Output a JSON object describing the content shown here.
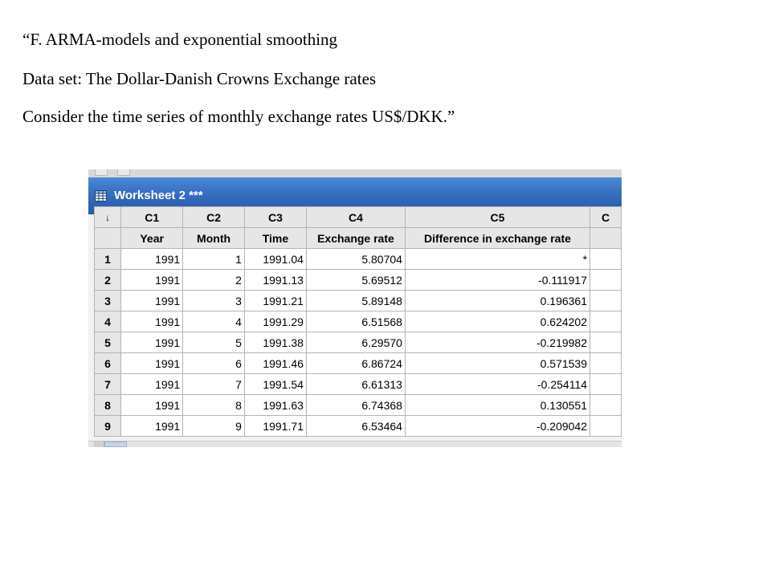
{
  "slide": {
    "line1": "“F. ARMA-models and exponential smoothing",
    "line2": "Data set:  The Dollar-Danish Crowns Exchange rates",
    "line3": "Consider the time series of monthly exchange rates US$/DKK.”"
  },
  "worksheet": {
    "title": "Worksheet 2 ***",
    "icon": "worksheet-grid-icon",
    "corner_arrow": "↓",
    "column_ids": [
      "C1",
      "C2",
      "C3",
      "C4",
      "C5",
      "C"
    ],
    "column_names": [
      "Year",
      "Month",
      "Time",
      "Exchange rate",
      "Difference in exchange rate",
      ""
    ],
    "rows": [
      {
        "n": "1",
        "year": "1991",
        "month": "1",
        "time": "1991.04",
        "rate": "5.80704",
        "diff": "*"
      },
      {
        "n": "2",
        "year": "1991",
        "month": "2",
        "time": "1991.13",
        "rate": "5.69512",
        "diff": "-0.111917"
      },
      {
        "n": "3",
        "year": "1991",
        "month": "3",
        "time": "1991.21",
        "rate": "5.89148",
        "diff": "0.196361"
      },
      {
        "n": "4",
        "year": "1991",
        "month": "4",
        "time": "1991.29",
        "rate": "6.51568",
        "diff": "0.624202"
      },
      {
        "n": "5",
        "year": "1991",
        "month": "5",
        "time": "1991.38",
        "rate": "6.29570",
        "diff": "-0.219982"
      },
      {
        "n": "6",
        "year": "1991",
        "month": "6",
        "time": "1991.46",
        "rate": "6.86724",
        "diff": "0.571539"
      },
      {
        "n": "7",
        "year": "1991",
        "month": "7",
        "time": "1991.54",
        "rate": "6.61313",
        "diff": "-0.254114"
      },
      {
        "n": "8",
        "year": "1991",
        "month": "8",
        "time": "1991.63",
        "rate": "6.74368",
        "diff": "0.130551"
      },
      {
        "n": "9",
        "year": "1991",
        "month": "9",
        "time": "1991.71",
        "rate": "6.53464",
        "diff": "-0.209042"
      }
    ]
  },
  "colors": {
    "titlebar": "#2e62b4",
    "header_bg": "#e6e6e6",
    "grid_line": "#b4b4b4"
  }
}
